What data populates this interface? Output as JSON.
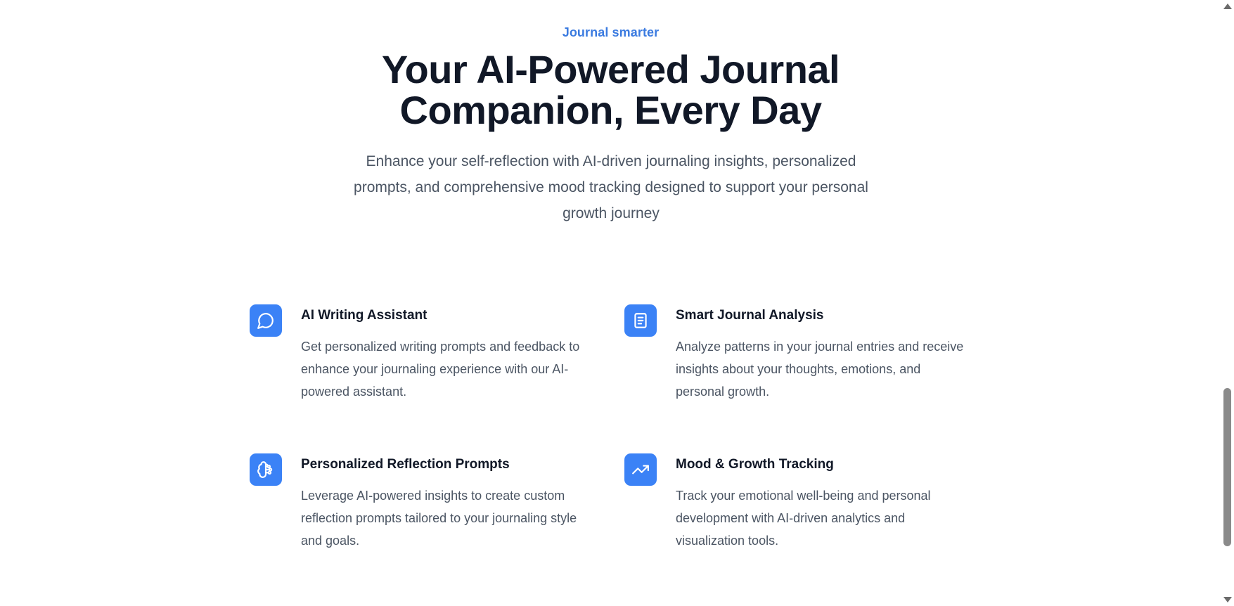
{
  "hero": {
    "eyebrow": "Journal smarter",
    "headline_line1": "Your AI-Powered Journal",
    "headline_line2": "Companion, Every Day",
    "lede": "Enhance your self-reflection with AI-driven journaling insights, personalized prompts, and comprehensive mood tracking designed to support your personal growth journey"
  },
  "features": [
    {
      "icon": "chat-bubble-icon",
      "title": "AI Writing Assistant",
      "description": "Get personalized writing prompts and feedback to enhance your journaling experience with our AI-powered assistant."
    },
    {
      "icon": "document-icon",
      "title": "Smart Journal Analysis",
      "description": "Analyze patterns in your journal entries and receive insights about your thoughts, emotions, and personal growth."
    },
    {
      "icon": "brain-icon",
      "title": "Personalized Reflection Prompts",
      "description": "Leverage AI-powered insights to create custom reflection prompts tailored to your journaling style and goals."
    },
    {
      "icon": "trending-up-icon",
      "title": "Mood & Growth Tracking",
      "description": "Track your emotional well-being and personal development with AI-driven analytics and visualization tools."
    }
  ],
  "colors": {
    "accent": "#3b82f6",
    "eyebrow": "#3b7be0",
    "heading": "#111827",
    "body": "#4b5563"
  }
}
